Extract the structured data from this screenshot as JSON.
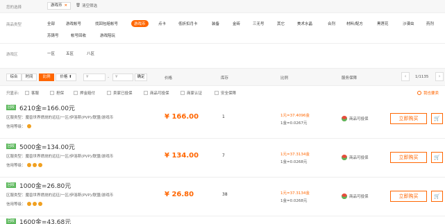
{
  "filters": {
    "selected_label": "您的选择",
    "selected_tag": "游戏币",
    "clear_label": "清空筛选",
    "category_label": "商品类型",
    "categories_row1": [
      "全部",
      "游戏帐号",
      "找回包赔帐号",
      "游戏币",
      "点卡",
      "低折扣月卡",
      "装备",
      "金砖",
      "三无号",
      "其它",
      "美术水晶",
      "合剂",
      "材料/配方",
      "黑莲花",
      "沙漠虫",
      "药剂"
    ],
    "categories_row2": [
      "苏铸号",
      "帐号回收",
      "游戏陪玩"
    ],
    "active_category": "游戏币",
    "region_label": "游戏区",
    "regions": [
      "一区",
      "五区",
      "八区"
    ]
  },
  "toolbar": {
    "sort_buttons": [
      "综合",
      "时间",
      "比例",
      "价格 ⬆"
    ],
    "active_sort": "比例",
    "price_from": "¥",
    "price_sep": "-",
    "price_to": "¥",
    "confirm": "确定",
    "col_price": "价格",
    "col_stock": "库存",
    "col_ratio": "比例",
    "col_guarantee": "服务保障",
    "page_info": "1/1135"
  },
  "checks": {
    "label": "只显示:",
    "options": [
      "客服",
      "担保",
      "押金赔付",
      "卖家已投保",
      "商品可投保",
      "商家认证",
      "安全保障"
    ],
    "right_label": "我也要卖"
  },
  "listings": [
    {
      "badge": "回收",
      "title": "6210金=166.00元",
      "region": "区服类型：魔兽世界燃烧的远征/一区/伊洛斯(PVP)/联盟/游戏币",
      "credit_label": "信用等级：",
      "crowns": 1,
      "price": "¥ 166.00",
      "stock": "1",
      "ratio1": "1元=37.4096金",
      "ratio2": "1金=0.0267元",
      "guarantee": "商品可投保",
      "buy": "立即购买",
      "cart": "🛒"
    },
    {
      "badge": "回收",
      "title": "5000金=134.00元",
      "region": "区服类型：魔兽世界燃烧的远征/一区/伊洛斯(PVP)/联盟/游戏币",
      "credit_label": "信用等级：",
      "crowns": 3,
      "price": "¥ 134.00",
      "stock": "7",
      "ratio1": "1元=37.3134金",
      "ratio2": "1金=0.0268元",
      "guarantee": "商品可投保",
      "buy": "立即购买",
      "cart": "🛒"
    },
    {
      "badge": "回收",
      "title": "1000金=26.80元",
      "region": "区服类型：魔兽世界燃烧的远征/一区/伊洛斯(PVP)/联盟/游戏币",
      "credit_label": "信用等级：",
      "crowns": 3,
      "price": "¥ 26.80",
      "stock": "38",
      "ratio1": "1元=37.3134金",
      "ratio2": "1金=0.0268元",
      "guarantee": "商品可投保",
      "buy": "立即购买",
      "cart": "🛒"
    },
    {
      "badge": "回收",
      "title": "1600金=43.68元"
    }
  ]
}
